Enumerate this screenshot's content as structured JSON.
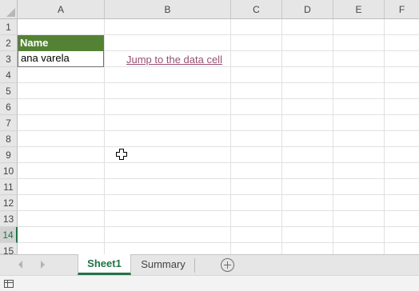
{
  "columns": [
    "A",
    "B",
    "C",
    "D",
    "E",
    "F"
  ],
  "rows": [
    "1",
    "2",
    "3",
    "4",
    "5",
    "6",
    "7",
    "8",
    "9",
    "10",
    "11",
    "12",
    "13",
    "14",
    "15"
  ],
  "selected_row": "14",
  "table": {
    "header": "Name",
    "value": "ana varela"
  },
  "hyperlink": {
    "text": "Jump to the data cell"
  },
  "sheet_tabs": {
    "active": "Sheet1",
    "other": "Summary"
  },
  "colors": {
    "table_header": "#548235",
    "hyperlink": "#954f72",
    "accent": "#217346"
  },
  "icons": {
    "cursor": "cell-select-cursor-icon",
    "add_sheet": "add-sheet-icon",
    "status": "cell-mode-icon"
  }
}
